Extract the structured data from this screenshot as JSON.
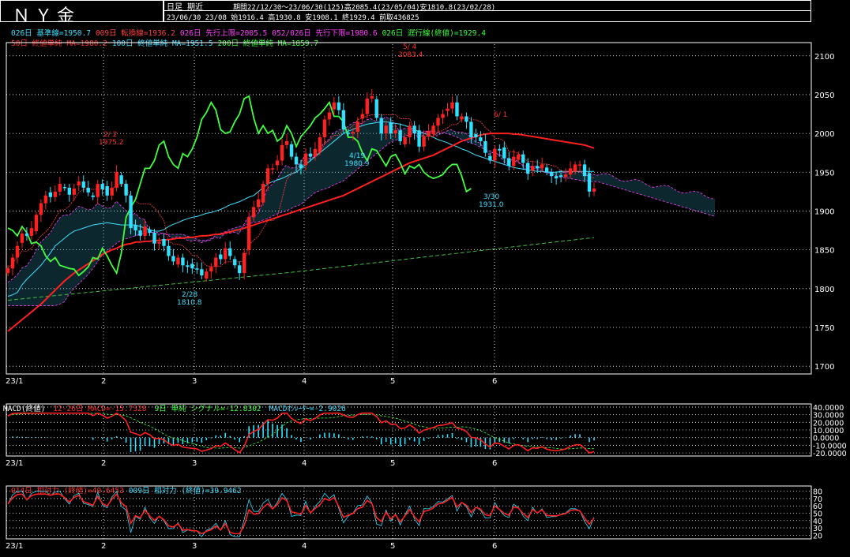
{
  "title": "ＮＹ金",
  "header": {
    "mode": "日足 期近",
    "period": "期間22/12/30～23/06/30(125)高2085.4(23/05/04)安1810.8(23/02/28)",
    "ohlc": "23/06/30 23/08 始1916.4 高1930.8 安1908.1 終1929.4 前取436825"
  },
  "legend_ichimoku": [
    {
      "text": "026日 基準線=1950.7",
      "color": "#40e0ff"
    },
    {
      "text": "009日 転換線=1936.2",
      "color": "#ff4040"
    },
    {
      "text": "026日 先行上限=2005.5",
      "color": "#ff40ff"
    },
    {
      "text": "052/026日 先行下限=1980.6",
      "color": "#ff40ff"
    },
    {
      "text": "026日 遅行線(終値)=1929.4",
      "color": "#40ff40"
    }
  ],
  "legend_ma": [
    {
      "text": "50日 終値単純 MA=1980.2",
      "color": "#ff3030"
    },
    {
      "text": "100日 終値単純 MA=1951.5",
      "color": "#40e0ff"
    },
    {
      "text": "200日 終値単純 MA=1859.7",
      "color": "#40ff40"
    }
  ],
  "legend_macd": [
    {
      "text": "MACD(終値)",
      "color": "#ffffff"
    },
    {
      "text": "12-26日 MACD=-15.7328",
      "color": "#ff3030"
    },
    {
      "text": "9日 単純 シグナル=-12.8302",
      "color": "#40ff40"
    },
    {
      "text": "MACDｵｼﾚｰﾀｰ=-2.9026",
      "color": "#40e0ff"
    }
  ],
  "legend_rsi": [
    {
      "text": "014日 相対力 (終値)=40.6453",
      "color": "#ff3030"
    },
    {
      "text": "009日 相対力 (終値)=39.9462",
      "color": "#40e0ff"
    }
  ],
  "annotations": [
    {
      "label": "5/ 4",
      "value": "2083.4",
      "color": "#ff3030"
    },
    {
      "label": "2/ 2",
      "value": "1975.2",
      "color": "#ff3030"
    },
    {
      "label": "6/ 1",
      "value": "",
      "color": "#ff3030"
    },
    {
      "label": "4/19",
      "value": "1980.9",
      "color": "#40e0ff"
    },
    {
      "label": "3/30",
      "value": "1931.0",
      "color": "#40e0ff"
    },
    {
      "label": "2/28",
      "value": "1810.8",
      "color": "#40e0ff"
    }
  ],
  "colors": {
    "up": "#ff2020",
    "down": "#30e0ff",
    "kijun": "#40e0ff",
    "tenkan": "#ff4040",
    "chikou": "#40ff40",
    "cloud": "#ff40ff",
    "ma50": "#ff2020",
    "ma200": "#40c040"
  },
  "chart_data": [
    {
      "type": "candlestick",
      "title": "ＮＹ金",
      "x_ticks": [
        "23/1",
        "2",
        "3",
        "4",
        "5",
        "6"
      ],
      "y_ticks": [
        1700,
        1750,
        1800,
        1850,
        1900,
        1950,
        2000,
        2050,
        2100
      ],
      "ylim": [
        1690,
        2115
      ],
      "close": [
        1826,
        1840,
        1855,
        1871,
        1868,
        1878,
        1895,
        1910,
        1920,
        1918,
        1925,
        1935,
        1930,
        1921,
        1929,
        1938,
        1930,
        1924,
        1918,
        1935,
        1928,
        1920,
        1930,
        1950,
        1935,
        1920,
        1878,
        1875,
        1868,
        1880,
        1872,
        1858,
        1860,
        1855,
        1842,
        1835,
        1840,
        1830,
        1828,
        1826,
        1825,
        1817,
        1822,
        1828,
        1840,
        1838,
        1852,
        1842,
        1830,
        1820,
        1846,
        1892,
        1905,
        1915,
        1935,
        1955,
        1955,
        1965,
        1985,
        1990,
        1970,
        1960,
        1955,
        1974,
        1970,
        1980,
        1995,
        2018,
        2027,
        2040,
        2030,
        2005,
        2000,
        2002,
        2015,
        2025,
        2045,
        2048,
        2020,
        2000,
        2010,
        2000,
        2004,
        1990,
        1995,
        2010,
        2000,
        1983,
        1996,
        2003,
        2010,
        2020,
        2025,
        2032,
        2040,
        2022,
        2022,
        2015,
        1995,
        1995,
        1990,
        1975,
        1965,
        1980,
        1978,
        1968,
        1958,
        1970,
        1973,
        1962,
        1948,
        1958,
        1955,
        1960,
        1950,
        1945,
        1942,
        1944,
        1947,
        1955,
        1960,
        1960,
        1945,
        1925,
        1929
      ],
      "kijun": [
        1790,
        1792,
        1795,
        1805,
        1812,
        1818,
        1824,
        1830,
        1838,
        1846,
        1855,
        1860,
        1865,
        1870,
        1874,
        1876,
        1878,
        1880,
        1882,
        1883,
        1884,
        1885,
        1884,
        1883,
        1882,
        1882,
        1882,
        1882,
        1880,
        1878,
        1876,
        1874,
        1874,
        1876,
        1880,
        1883,
        1885,
        1888,
        1890,
        1892,
        1893,
        1895,
        1897,
        1898,
        1900,
        1902,
        1905,
        1908,
        1910,
        1912,
        1915,
        1918,
        1920,
        1925,
        1930,
        1935,
        1938,
        1940,
        1942,
        1945,
        1948,
        1950,
        1955,
        1960,
        1965,
        1970,
        1975,
        1980,
        1985,
        1990,
        1995,
        2000,
        2003,
        2005,
        2008,
        2010,
        2012,
        2013,
        2014,
        2015,
        2015,
        2014,
        2013,
        2012,
        2010,
        2008,
        2005,
        2002,
        2000,
        1998,
        1995,
        1992,
        1990,
        1988,
        1985,
        1983,
        1980,
        1978,
        1975,
        1972,
        1970,
        1968,
        1966,
        1964,
        1962,
        1960,
        1958,
        1956,
        1955,
        1954,
        1953,
        1952,
        1951,
        1951,
        1950,
        1950,
        1950,
        1951,
        1951,
        1951,
        1951,
        1951,
        1951,
        1951,
        1951
      ],
      "ma50": [
        1745,
        1750,
        1755,
        1760,
        1765,
        1770,
        1775,
        1780,
        1786,
        1792,
        1798,
        1804,
        1810,
        1815,
        1820,
        1824,
        1828,
        1832,
        1836,
        1840,
        1844,
        1847,
        1850,
        1852,
        1855,
        1857,
        1858,
        1860,
        1860,
        1861,
        1861,
        1862,
        1862,
        1863,
        1863,
        1864,
        1865,
        1865,
        1866,
        1866,
        1867,
        1868,
        1868,
        1869,
        1870,
        1870,
        1872,
        1873,
        1875,
        1876,
        1878,
        1880,
        1882,
        1884,
        1886,
        1888,
        1890,
        1892,
        1894,
        1896,
        1898,
        1900,
        1902,
        1904,
        1906,
        1908,
        1910,
        1912,
        1914,
        1916,
        1918,
        1920,
        1923,
        1926,
        1929,
        1932,
        1935,
        1938,
        1941,
        1944,
        1947,
        1950,
        1953,
        1956,
        1959,
        1962,
        1964,
        1966,
        1968,
        1970,
        1972,
        1975,
        1978,
        1981,
        1984,
        1987,
        1990,
        1992,
        1994,
        1996,
        1998,
        1999,
        2000,
        2000,
        2000,
        2000,
        2000,
        1999,
        1999,
        1998,
        1997,
        1996,
        1995,
        1994,
        1993,
        1992,
        1991,
        1990,
        1989,
        1988,
        1987,
        1986,
        1985,
        1983,
        1981
      ]
    },
    {
      "type": "line",
      "title": "MACD(終値)",
      "y_ticks": [
        40,
        30,
        20,
        10,
        0,
        -10,
        -20
      ],
      "ylim": [
        -24,
        42
      ]
    },
    {
      "type": "line",
      "title": "相対力",
      "y_ticks": [
        80,
        70,
        60,
        50,
        40,
        30,
        20
      ],
      "ylim": [
        15,
        85
      ]
    }
  ]
}
